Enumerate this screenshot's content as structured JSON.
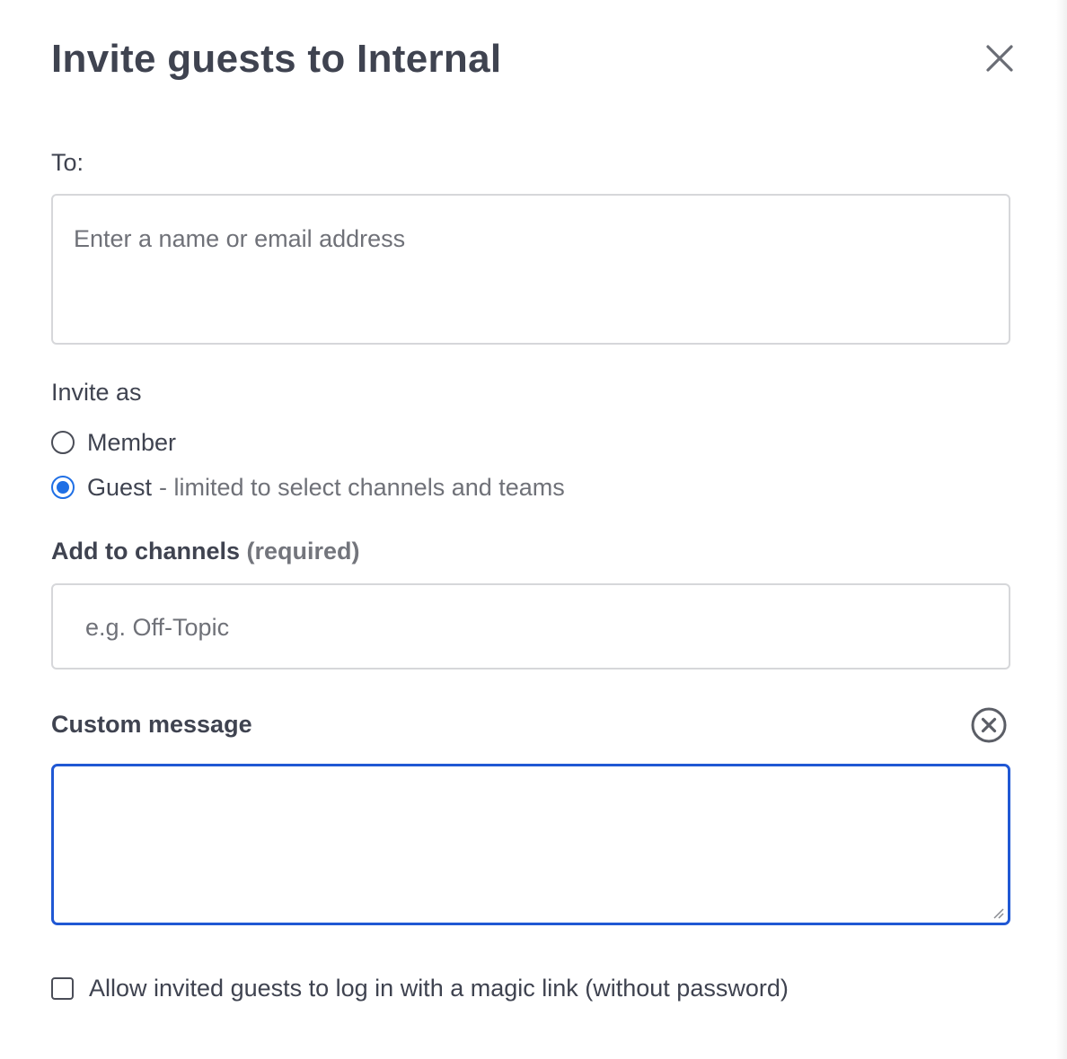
{
  "dialog": {
    "title": "Invite guests to Internal",
    "close_icon": "close-icon"
  },
  "to": {
    "label": "To:",
    "placeholder": "Enter a name or email address",
    "value": ""
  },
  "invite_as": {
    "label": "Invite as",
    "options": [
      {
        "label": "Member",
        "description": "",
        "selected": false
      },
      {
        "label": "Guest",
        "description": "- limited to select channels and teams",
        "selected": true
      }
    ]
  },
  "channels": {
    "label": "Add to channels",
    "required_note": "(required)",
    "placeholder": "e.g. Off-Topic",
    "value": ""
  },
  "custom_message": {
    "label": "Custom message",
    "value": "",
    "clear_icon": "circle-x-icon"
  },
  "magic_link": {
    "label": "Allow invited guests to log in with a magic link (without password)",
    "checked": false
  },
  "colors": {
    "text": "#3f4350",
    "muted": "#6f7178",
    "border": "#d6d7da",
    "focus": "#2058d4",
    "radio_selected": "#1f6fe5"
  }
}
